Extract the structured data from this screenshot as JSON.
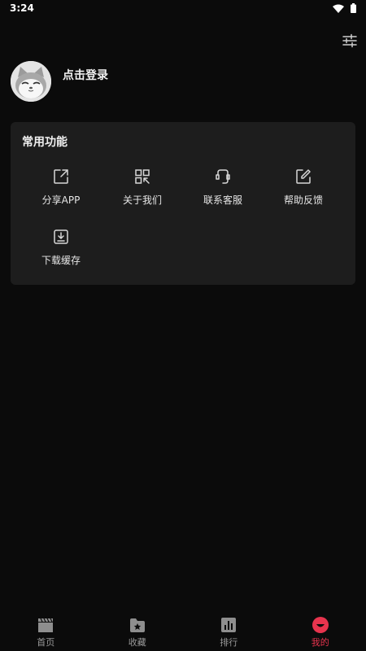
{
  "status_bar": {
    "time": "3:24"
  },
  "profile": {
    "login_label": "点击登录"
  },
  "card": {
    "title": "常用功能",
    "items": [
      {
        "label": "分享APP",
        "icon": "share-icon"
      },
      {
        "label": "关于我们",
        "icon": "qrcode-icon"
      },
      {
        "label": "联系客服",
        "icon": "headset-icon"
      },
      {
        "label": "帮助反馈",
        "icon": "edit-icon"
      },
      {
        "label": "下载缓存",
        "icon": "download-icon"
      }
    ]
  },
  "bottom_nav": {
    "items": [
      {
        "label": "首页",
        "icon": "clapperboard-icon",
        "active": false
      },
      {
        "label": "收藏",
        "icon": "star-folder-icon",
        "active": false
      },
      {
        "label": "排行",
        "icon": "bar-chart-icon",
        "active": false
      },
      {
        "label": "我的",
        "icon": "smile-icon",
        "active": true
      }
    ]
  },
  "colors": {
    "accent": "#e8344e",
    "background": "#0b0b0b",
    "card": "#1d1d1d"
  }
}
